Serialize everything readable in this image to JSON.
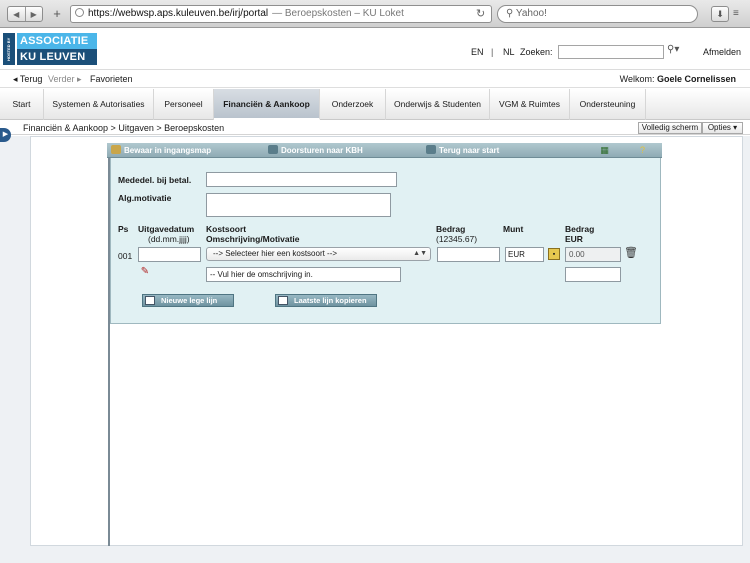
{
  "browser": {
    "url": "https://webwsp.aps.kuleuven.be/irj/portal",
    "page_title": "— Beroepskosten – KU Loket",
    "search_placeholder": "Yahoo!"
  },
  "header": {
    "hosted_by": "HOSTED BY",
    "logo_line1": "ASSOCIATIE",
    "logo_line2": "KU LEUVEN",
    "lang_en": "EN",
    "separator": "|",
    "lang_nl": "NL",
    "search_label": "Zoeken:",
    "logout": "Afmelden"
  },
  "nav": {
    "back": "◂ Terug",
    "forward": "Verder ▸",
    "favorites": "Favorieten",
    "welcome_prefix": "Welkom:",
    "welcome_name": "Goele Cornelissen"
  },
  "tabs": [
    {
      "label": "Start"
    },
    {
      "label": "Systemen & Autorisaties"
    },
    {
      "label": "Personeel"
    },
    {
      "label": "Financiën & Aankoop"
    },
    {
      "label": "Onderzoek"
    },
    {
      "label": "Onderwijs & Studenten"
    },
    {
      "label": "VGM & Ruimtes"
    },
    {
      "label": "Ondersteuning"
    }
  ],
  "breadcrumb": "Financiën & Aankoop  >  Uitgaven  >  Beroepskosten",
  "page_buttons": {
    "fullscreen": "Volledig scherm",
    "options": "Opties ▾"
  },
  "toolbar": {
    "save": "Bewaar in ingangsmap",
    "forward": "Doorsturen naar KBH",
    "back_to_start": "Terug naar start"
  },
  "form": {
    "label_mededel": "Mededel. bij betal.",
    "label_motivatie": "Alg.motivatie",
    "col_ps": "Ps",
    "col_date": "Uitgavedatum",
    "col_date_format": "(dd.mm.jjjj)",
    "col_kostsoort": "Kostsoort",
    "col_omschrijving": "Omschrijving/Motivatie",
    "col_bedrag": "Bedrag",
    "col_bedrag_format": "(12345.67)",
    "col_munt": "Munt",
    "col_bedrag_eur": "Bedrag",
    "col_bedrag_eur_unit": "EUR",
    "row_number": "001",
    "kostsoort_select": "-->       Selecteer hier een kostsoort          -->",
    "munt_value": "EUR",
    "eur_value": "0.00",
    "omschrijving_value": "-- Vul hier de omschrijving in.",
    "btn_new_line": "Nieuwe lege lijn",
    "btn_copy_line": "Laatste lijn kopieren"
  }
}
